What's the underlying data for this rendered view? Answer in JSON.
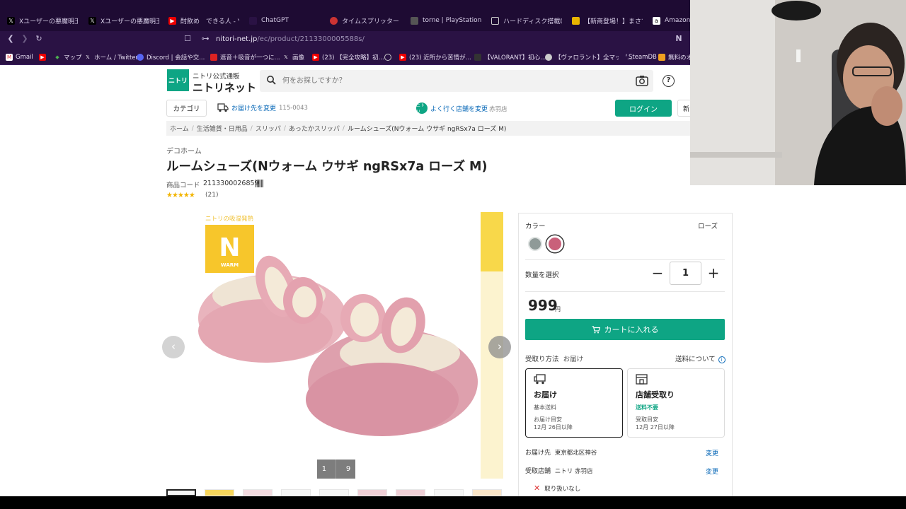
{
  "browser": {
    "tabs": [
      {
        "label": "Xユーザーの悪魔明王[松",
        "icon": "x-icon"
      },
      {
        "label": "Xユーザーの悪魔明王[松",
        "icon": "x-icon"
      },
      {
        "label": "酎飲め　できる人 - You",
        "icon": "youtube-icon"
      },
      {
        "label": "ChatGPT",
        "icon": "chatgpt-icon"
      },
      {
        "label": "タイムスプリッター　ｐｓ",
        "icon": "site-icon"
      },
      {
        "label": "torne | PlayStation",
        "icon": "playstation-icon"
      },
      {
        "label": "ハードディスク搭載DVDレ",
        "icon": "site-icon"
      },
      {
        "label": "【新商登場！】まさで国",
        "icon": "site-icon"
      },
      {
        "label": "Amazon.co",
        "icon": "amazon-icon"
      }
    ],
    "url_host": "nitori-net.jp",
    "url_path": "/ec/product/2113300005588s/",
    "bookmarks": [
      "Gmail",
      "",
      "マップ",
      "ホーム / Twitter",
      "Discord | 会話や交...",
      "遮音＋吸音が一つに...",
      "画像",
      "(23) 【完全攻略】初...",
      "",
      "(23) 近所から苦情が...",
      "【VALORANT】初心...",
      "【ヴァロラント】全マップ...",
      "SteamDB",
      "無料のオ"
    ]
  },
  "header": {
    "logo_box": "ニトリ",
    "logo_sub": "ニトリ公式通販",
    "logo_main": "ニトリネット",
    "search_placeholder": "何をお探しですか？",
    "category": "カテゴリ",
    "delivery_link": "お届け先を変更",
    "delivery_zip": "115-0043",
    "store_link": "よく行く店舗を変更",
    "store_name": "赤羽店",
    "login": "ログイン",
    "register": "新"
  },
  "breadcrumbs": [
    "ホーム",
    "生活雑貨・日用品",
    "スリッパ",
    "あったかスリッパ",
    "ルームシューズ(Nウォーム ウサギ ngRSx7a ローズ M)"
  ],
  "product": {
    "brand": "デコホーム",
    "title": "ルームシューズ(Nウォーム ウサギ ngRSx7a ローズ M)",
    "code_label": "商品コード",
    "code": "2113300026859",
    "stars": "★★★★★",
    "rating": 5,
    "review_count": "(21)"
  },
  "gallery": {
    "badge_caption": "ニトリの吸湿発熱",
    "badge_letter": "N",
    "badge_word": "WARM",
    "page_current": "1",
    "page_total": "9"
  },
  "purchase": {
    "color_label": "カラー",
    "color_value": "ローズ",
    "swatches": [
      {
        "name": "gray",
        "color": "#8f9a98"
      },
      {
        "name": "rose",
        "color": "#c9607a"
      }
    ],
    "qty_label": "数量を選択",
    "qty": "1",
    "price": "999",
    "yen": "円",
    "cart_button": "カートに入れる",
    "receive_label": "受取り方法",
    "receive_value": "お届け",
    "shipping_link": "送料について",
    "options": [
      {
        "title": "お届け",
        "sub": "基本送料",
        "meta1": "お届け目安",
        "meta2": "12月 26日以降",
        "selected": true
      },
      {
        "title": "店舗受取り",
        "sub": "送料不要",
        "meta1": "受取目安",
        "meta2": "12月 27日以降",
        "selected": false
      }
    ],
    "dest_label": "お届け先",
    "dest_value": "東京都北区神谷",
    "store_label": "受取店舗",
    "store_value": "ニトリ 赤羽店",
    "change": "変更",
    "no_handling": "取り扱いなし"
  },
  "colors": {
    "brand": "#0ea584",
    "link": "#0b6ab8",
    "tabstrip": "#1e0b33",
    "toolbar": "#2a1244"
  }
}
